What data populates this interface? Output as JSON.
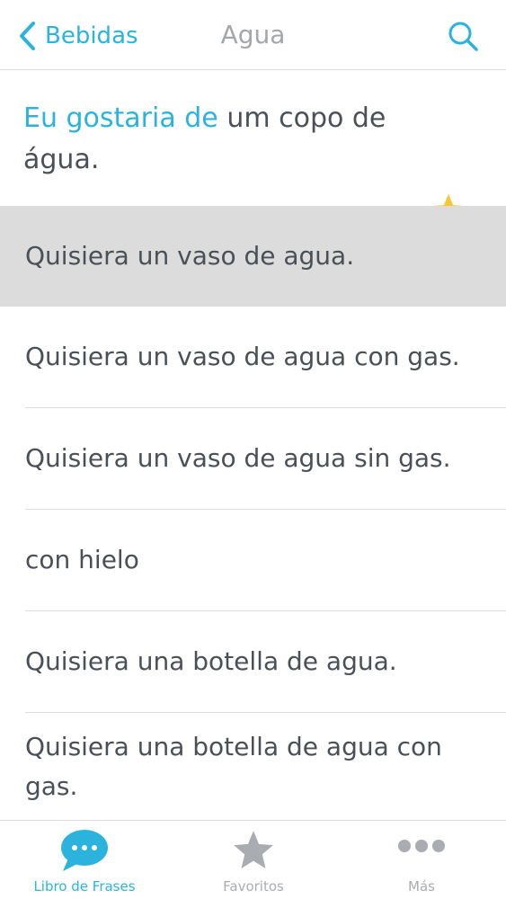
{
  "nav": {
    "back_label": "Bebidas",
    "title": "Agua"
  },
  "header": {
    "highlight": "Eu gostaria de",
    "rest": " um copo de água."
  },
  "phrases": [
    "Quisiera un vaso de agua.",
    "Quisiera un vaso de agua con gas.",
    "Quisiera un vaso de agua sin gas.",
    "con hielo",
    "Quisiera una botella de agua.",
    "Quisiera una botella de agua con gas."
  ],
  "tabs": {
    "phrasebook": "Libro de Frases",
    "favorites": "Favoritos",
    "more": "Más"
  },
  "colors": {
    "accent": "#2bb3de",
    "star": "#f9c933",
    "selected_row": "#dcdcdc",
    "inactive_tab": "#a9adb1"
  }
}
